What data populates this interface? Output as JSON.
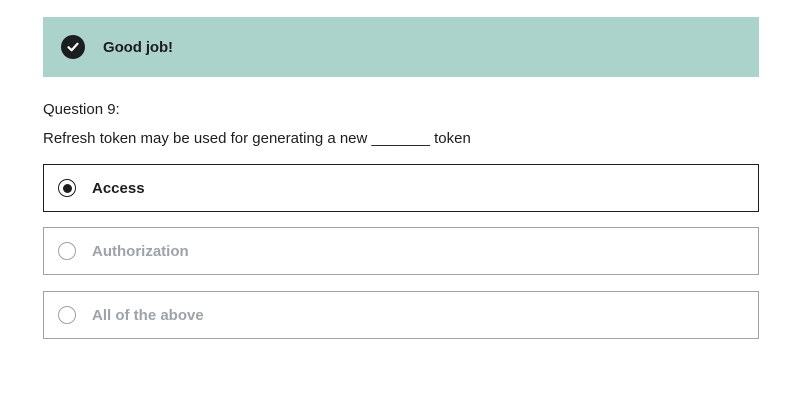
{
  "feedback": {
    "message": "Good job!",
    "icon": "check-circle-icon",
    "background_color": "#acd2cc"
  },
  "question": {
    "label": "Question 9:",
    "prompt": "Refresh token may be used for generating a new _______ token"
  },
  "options": [
    {
      "label": "Access",
      "selected": true
    },
    {
      "label": "Authorization",
      "selected": false
    },
    {
      "label": "All of the above",
      "selected": false
    }
  ]
}
